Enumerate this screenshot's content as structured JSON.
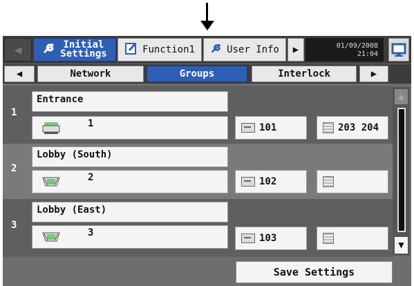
{
  "top_tabs": {
    "initial_settings": "Initial\nSettings",
    "function1": "Function1",
    "user_info": "User Info"
  },
  "clock": {
    "date": "01/09/2008",
    "time": "21:04"
  },
  "sub_tabs": {
    "network": "Network",
    "groups": "Groups",
    "interlock": "Interlock"
  },
  "groups": [
    {
      "index": "1",
      "name": "Entrance",
      "unit": "1",
      "controller": "101",
      "other": "203 204"
    },
    {
      "index": "2",
      "name": "Lobby (South)",
      "unit": "2",
      "controller": "102",
      "other": ""
    },
    {
      "index": "3",
      "name": "Lobby (East)",
      "unit": "3",
      "controller": "103",
      "other": ""
    }
  ],
  "buttons": {
    "save": "Save Settings"
  },
  "icons": {
    "prev": "triangle-left-icon",
    "next": "triangle-right-icon",
    "wrench": "wrench-icon",
    "edit": "edit-icon",
    "monitor": "monitor-icon",
    "scroll_up": "triangle-up-icon",
    "scroll_down": "triangle-down-icon"
  },
  "colors": {
    "active_tab": "#2f5fb5",
    "unit_green": "#7bc67b"
  }
}
